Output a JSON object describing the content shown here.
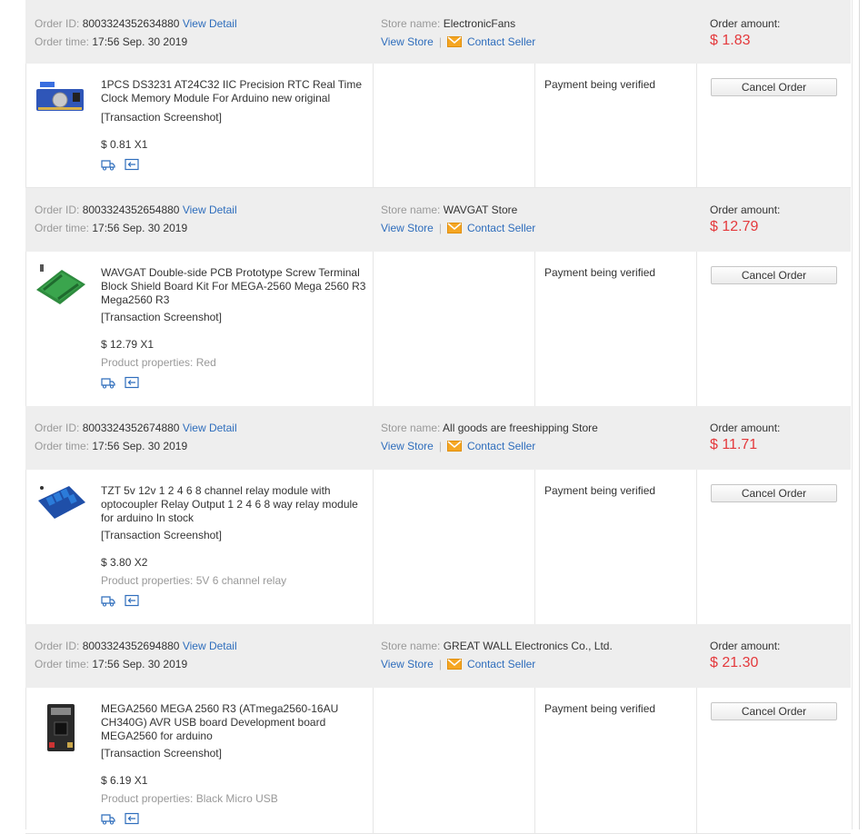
{
  "labels": {
    "order_id": "Order ID:",
    "view_detail": "View Detail",
    "order_time": "Order time:",
    "store_name": "Store name:",
    "view_store": "View Store",
    "separator": "|",
    "contact_seller": "Contact Seller",
    "order_amount": "Order amount:",
    "cancel_order": "Cancel Order",
    "transaction_screenshot": "[Transaction Screenshot]",
    "product_properties": "Product properties:"
  },
  "orders": [
    {
      "id": "8003324352634880",
      "time": "17:56 Sep. 30 2019",
      "store": "ElectronicFans",
      "amount": "$ 1.83",
      "product": {
        "title": "1PCS DS3231 AT24C32 IIC Precision RTC Real Time Clock Memory Module For Arduino new original",
        "price_qty": "$ 0.81 X1",
        "properties": ""
      },
      "status": "Payment being verified"
    },
    {
      "id": "8003324352654880",
      "time": "17:56 Sep. 30 2019",
      "store": "WAVGAT Store",
      "amount": "$ 12.79",
      "product": {
        "title": "WAVGAT Double-side PCB Prototype Screw Terminal Block Shield Board Kit For MEGA-2560 Mega 2560 R3 Mega2560 R3",
        "price_qty": "$ 12.79 X1",
        "properties": "Red"
      },
      "status": "Payment being verified"
    },
    {
      "id": "8003324352674880",
      "time": "17:56 Sep. 30 2019",
      "store": "All goods are freeshipping Store",
      "amount": "$ 11.71",
      "product": {
        "title": "TZT 5v 12v 1 2 4 6 8 channel relay module with optocoupler Relay Output 1 2 4 6 8 way relay module for arduino In stock",
        "price_qty": "$ 3.80 X2",
        "properties": "5V 6 channel relay"
      },
      "status": "Payment being verified"
    },
    {
      "id": "8003324352694880",
      "time": "17:56 Sep. 30 2019",
      "store": "GREAT WALL Electronics Co., Ltd.",
      "amount": "$ 21.30",
      "product": {
        "title": "MEGA2560 MEGA 2560 R3 (ATmega2560-16AU CH340G) AVR USB board Development board MEGA2560 for arduino",
        "price_qty": "$ 6.19 X1",
        "properties": "Black Micro USB"
      },
      "status": "Payment being verified"
    }
  ],
  "icons": {
    "thumbnails": [
      "rtc-module-thumbnail",
      "screw-shield-thumbnail",
      "relay-module-thumbnail",
      "mega2560-board-thumbnail"
    ],
    "action_icons": [
      "shipping-truck-icon",
      "return-icon"
    ],
    "mail": "envelope-icon"
  },
  "colors": {
    "header_bg": "#eeeeee",
    "link": "#2e6dbc",
    "amount": "#e4393c",
    "muted": "#999999",
    "mail_icon": "#f5a623"
  }
}
